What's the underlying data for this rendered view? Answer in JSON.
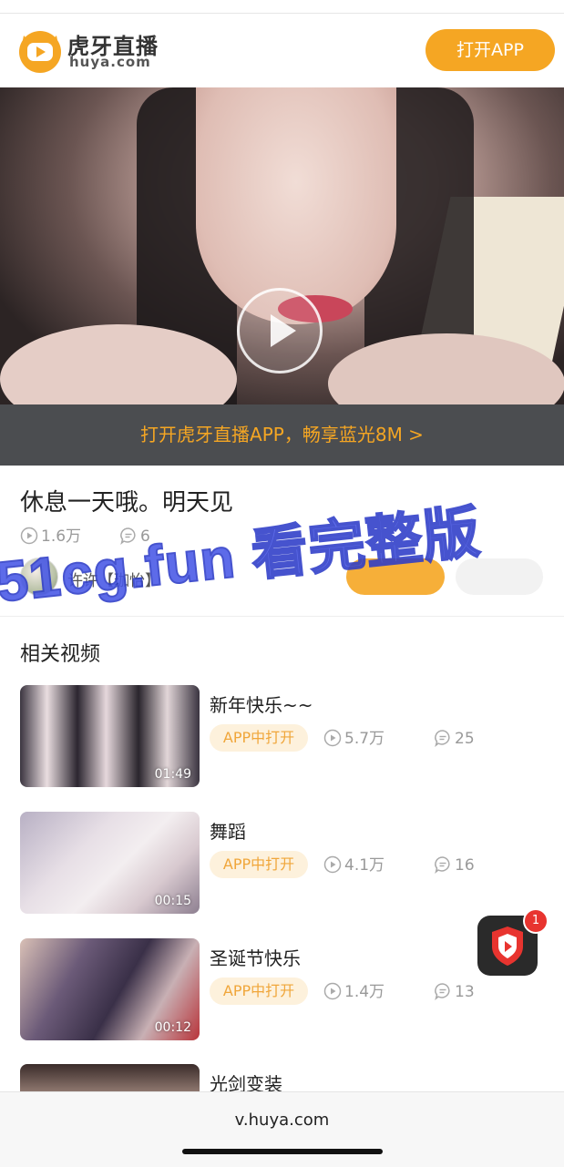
{
  "header": {
    "logo_cn": "虎牙直播",
    "logo_en": "huya.com",
    "open_app_label": "打开APP"
  },
  "video": {
    "promo_text": "打开虎牙直播APP，畅享蓝光8M >"
  },
  "post": {
    "title": "休息一天哦。明天见",
    "views": "1.6万",
    "comments": "6",
    "author_name": "许许【珈怡】"
  },
  "watermark": {
    "text": "51cg.fun 看完整版"
  },
  "related": {
    "section_title": "相关视频",
    "items": [
      {
        "title": "新年快乐~~",
        "tag": "APP中打开",
        "views": "5.7万",
        "comments": "25",
        "duration": "01:49"
      },
      {
        "title": "舞蹈",
        "tag": "APP中打开",
        "views": "4.1万",
        "comments": "16",
        "duration": "00:15"
      },
      {
        "title": "圣诞节快乐",
        "tag": "APP中打开",
        "views": "1.4万",
        "comments": "13",
        "duration": "00:12"
      },
      {
        "title": "光剑变装"
      }
    ]
  },
  "float_app": {
    "badge": "1"
  },
  "browser": {
    "url": "v.huya.com"
  },
  "colors": {
    "accent": "#f5a623",
    "promo_bar_bg": "#4b4d50",
    "watermark": "#4757e6",
    "badge": "#e8342f"
  }
}
